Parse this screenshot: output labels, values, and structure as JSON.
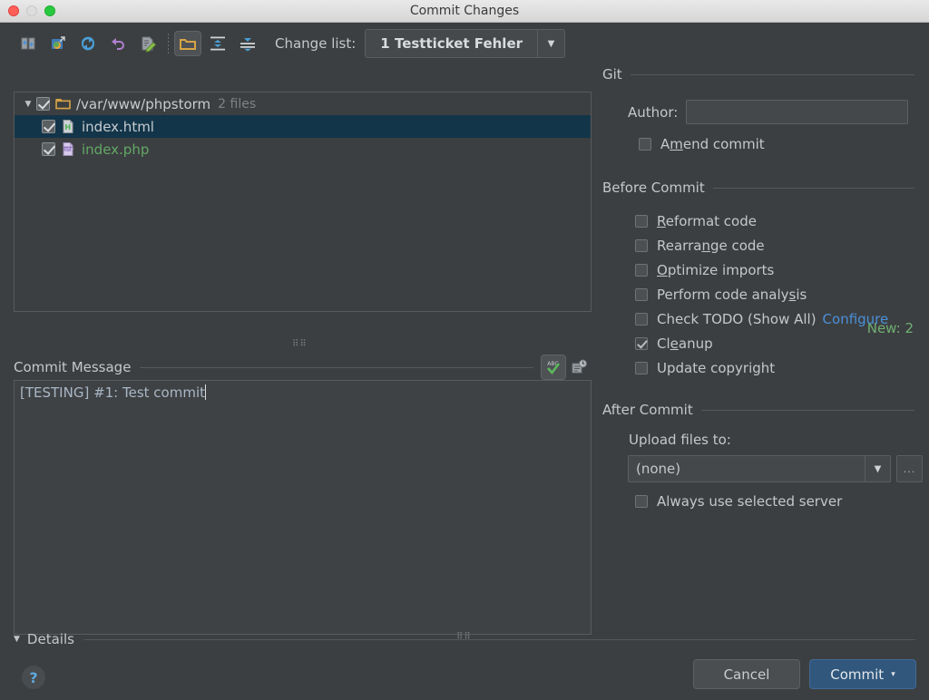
{
  "window": {
    "title": "Commit Changes",
    "controls": [
      {
        "name": "close-button",
        "color": "#ff5f57"
      },
      {
        "name": "minimize-button",
        "color": "#dddddd"
      },
      {
        "name": "zoom-button",
        "color": "#28c940"
      }
    ]
  },
  "toolbar": {
    "icons": [
      {
        "name": "show-diff-icon",
        "title": "Show Diff"
      },
      {
        "name": "revert-to-icon",
        "title": "Move to Another Changelist"
      },
      {
        "name": "refresh-icon",
        "title": "Refresh"
      },
      {
        "name": "rollback-icon",
        "title": "Rollback"
      },
      {
        "name": "edit-source-icon",
        "title": "Edit Source"
      },
      {
        "name": "group-by-directory-icon",
        "title": "Group by Directory",
        "pressed": true
      },
      {
        "name": "expand-all-icon",
        "title": "Expand All"
      },
      {
        "name": "collapse-all-icon",
        "title": "Collapse All"
      }
    ],
    "change_list_label": "Change list:",
    "change_list_value": "1 Testticket Fehler",
    "dropdown_glyph": "▼"
  },
  "tree": {
    "root": {
      "twisty": "▼",
      "checked": true,
      "icon": "folder-icon",
      "path": "/var/www/phpstorm",
      "count": "2 files"
    },
    "files": [
      {
        "checked": true,
        "icon": "html-file-icon",
        "name": "index.html",
        "color": "#c8cccf",
        "selected": true
      },
      {
        "checked": true,
        "icon": "php-file-icon",
        "name": "index.php",
        "color": "#62a866",
        "selected": false
      }
    ],
    "new_count": "New: 2"
  },
  "commit_message": {
    "label": "Commit Message",
    "value": "[TESTING] #1: Test commit",
    "buttons": [
      {
        "name": "spellcheck-toggle-icon",
        "label": "ABC",
        "pressed": true
      },
      {
        "name": "commit-message-history-icon",
        "pressed": false
      }
    ]
  },
  "git": {
    "group_label": "Git",
    "author_label": "Author:",
    "author_value": "",
    "amend": {
      "label": "Amend commit",
      "mnemonic_index": 1,
      "checked": false
    }
  },
  "before_commit": {
    "group_label": "Before Commit",
    "items": [
      {
        "label": "Reformat code",
        "mnemonic_index": 0,
        "checked": false
      },
      {
        "label": "Rearrange code",
        "mnemonic_index": 8,
        "checked": false
      },
      {
        "label": "Optimize imports",
        "mnemonic_index": 0,
        "checked": false
      },
      {
        "label": "Perform code analysis",
        "mnemonic_index": 18,
        "checked": false
      },
      {
        "label": "Check TODO (Show All)",
        "mnemonic_index": -1,
        "checked": false,
        "link": "Configure"
      },
      {
        "label": "Cleanup",
        "mnemonic_index": 2,
        "checked": true
      },
      {
        "label": "Update copyright",
        "mnemonic_index": -1,
        "checked": false
      }
    ]
  },
  "after_commit": {
    "group_label": "After Commit",
    "upload_label": "Upload files to:",
    "upload_value": "(none)",
    "dropdown_glyph": "▼",
    "browse_label": "...",
    "always_use": {
      "label": "Always use selected server",
      "checked": false
    }
  },
  "footer": {
    "details_twisty": "▼",
    "details_label": "Details",
    "help_label": "?",
    "cancel_label": "Cancel",
    "commit_label": "Commit",
    "commit_arrow": "▾"
  },
  "colors": {
    "background": "#3c3f41",
    "selection": "#13354a",
    "accent_link": "#4a90d9",
    "new_count": "#6faf72",
    "commit_button": "#31577d"
  }
}
